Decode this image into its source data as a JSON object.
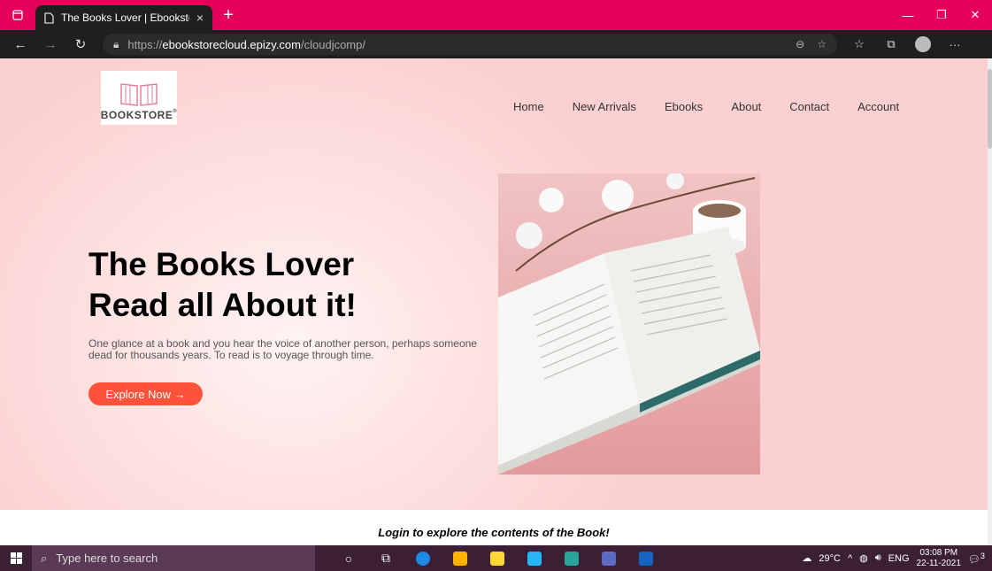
{
  "browser": {
    "tab_title": "The Books Lover | Ebookstore",
    "tab_close": "×",
    "new_tab": "+",
    "url_prefix": "https://",
    "url_domain": "ebookstorecloud.epizy.com",
    "url_path": "/cloudjcomp/"
  },
  "site": {
    "logo_text": "BOOKSTORE",
    "logo_reg": "®",
    "nav": [
      "Home",
      "New Arrivals",
      "Ebooks",
      "About",
      "Contact",
      "Account"
    ]
  },
  "hero": {
    "headline_line1": "The Books Lover",
    "headline_line2": "Read all About it!",
    "description": "One glance at a book and you hear the voice of another person, perhaps someone dead for thousands years. To read is to voyage through time.",
    "button_label": "Explore Now →"
  },
  "login_banner": "Login to explore the contents of the Book!",
  "taskbar": {
    "search_placeholder": "Type here to search",
    "weather": "29°C",
    "language": "ENG",
    "time": "03:08 PM",
    "date": "22-11-2021",
    "notification_count": "3"
  },
  "colors": {
    "tab_bar": "#e6005c",
    "accent_button": "#ff523b",
    "hero_bg": "#fde0df"
  }
}
